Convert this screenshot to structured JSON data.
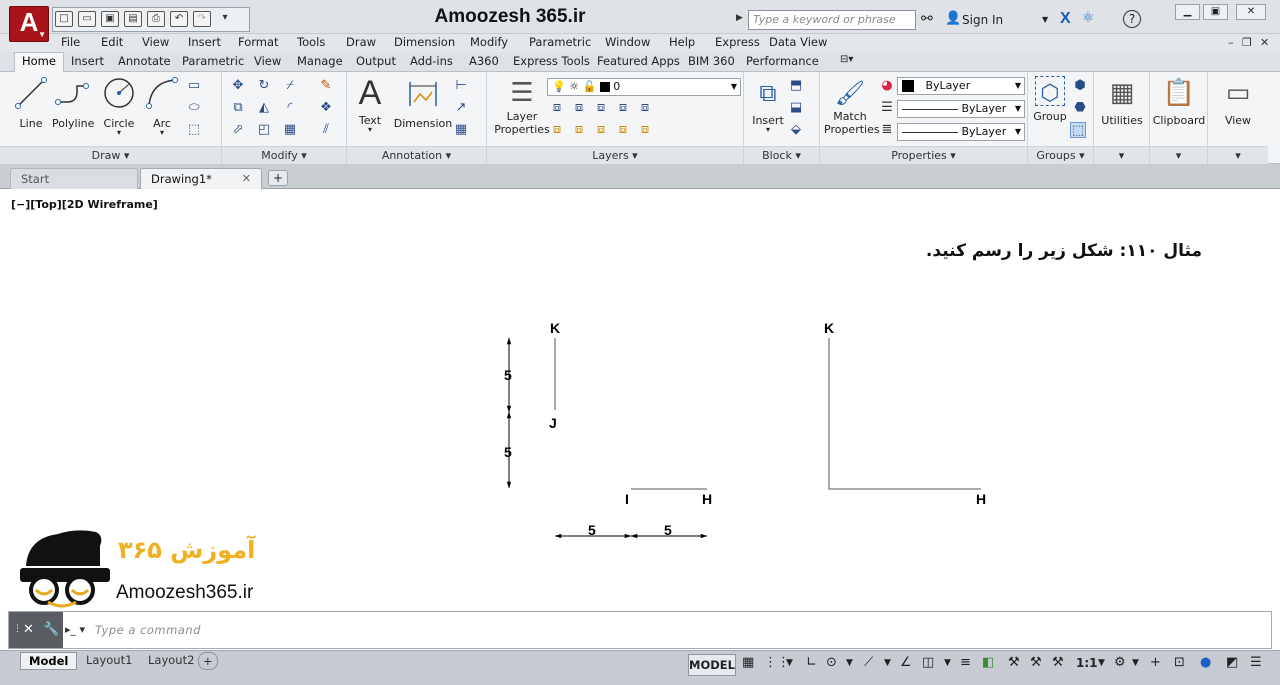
{
  "title_bar": {
    "app_letter": "A",
    "title": "Amoozesh 365.ir",
    "search_placeholder": "Type a keyword or phrase",
    "sign_in": "Sign In",
    "help_icon": "?",
    "qat_icons": [
      "new-icon",
      "open-icon",
      "save-icon",
      "save-as-icon",
      "print-icon",
      "undo-icon",
      "redo-icon",
      "customize-icon"
    ]
  },
  "menu": [
    "File",
    "Edit",
    "View",
    "Insert",
    "Format",
    "Tools",
    "Draw",
    "Dimension",
    "Modify",
    "Parametric",
    "Window",
    "Help",
    "Express",
    "Data View"
  ],
  "ribbon_tabs": [
    "Home",
    "Insert",
    "Annotate",
    "Parametric",
    "View",
    "Manage",
    "Output",
    "Add-ins",
    "A360",
    "Express Tools",
    "Featured Apps",
    "BIM 360",
    "Performance"
  ],
  "ribbon": {
    "draw": {
      "title": "Draw",
      "line": "Line",
      "polyline": "Polyline",
      "circle": "Circle",
      "arc": "Arc"
    },
    "modify": {
      "title": "Modify"
    },
    "annotation": {
      "title": "Annotation",
      "text": "Text",
      "dimension": "Dimension"
    },
    "layers": {
      "title": "Layers",
      "layer_properties_1": "Layer",
      "layer_properties_2": "Properties",
      "layer_value": "0"
    },
    "block": {
      "title": "Block",
      "insert": "Insert"
    },
    "properties": {
      "title": "Properties",
      "match_1": "Match",
      "match_2": "Properties",
      "color": "ByLayer",
      "linetype": "ByLayer",
      "lineweight": "ByLayer"
    },
    "groups": {
      "title": "Groups",
      "group": "Group"
    },
    "utilities": "Utilities",
    "clipboard": "Clipboard",
    "view": "View"
  },
  "doc_tabs": {
    "start": "Start",
    "drawing": "Drawing1*"
  },
  "viewport_label": "[−][Top][2D Wireframe]",
  "drawing": {
    "instruction": "مثال ۱۱۰: شکل زیر را رسم کنید.",
    "left_figure": {
      "K": "K",
      "J": "J",
      "I": "I",
      "H": "H",
      "dim_v1": "5",
      "dim_v2": "5",
      "dim_h1": "5",
      "dim_h2": "5"
    },
    "right_figure": {
      "K": "K",
      "H": "H"
    },
    "logo_text": "Amoozesh365.ir",
    "logo_persian": "آموزش ۳۶۵"
  },
  "command_line": {
    "placeholder": "Type  a  command"
  },
  "status_bar": {
    "layouts": [
      "Model",
      "Layout1",
      "Layout2"
    ],
    "space": "MODEL",
    "scale": "1:1"
  }
}
